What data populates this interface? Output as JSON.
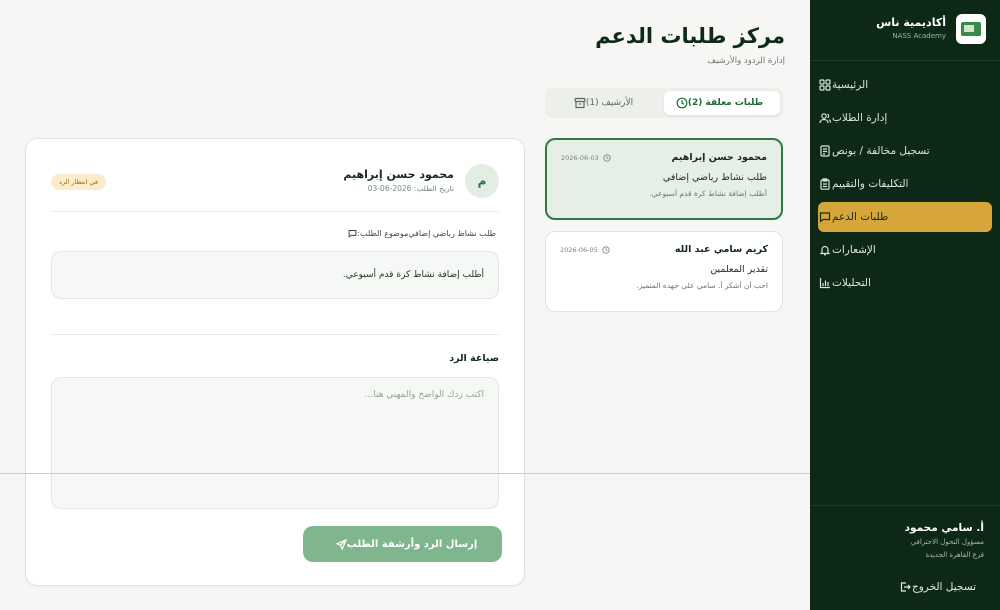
{
  "brand": {
    "name": "أكاديمية ناس",
    "subtitle": "NASS Academy"
  },
  "nav": {
    "items": [
      {
        "label": "الرئيسية",
        "icon": "grid-icon",
        "active": false
      },
      {
        "label": "إدارة الطلاب",
        "icon": "users-icon",
        "active": false
      },
      {
        "label": "تسجيل مخالفة / بونص",
        "icon": "note-icon",
        "active": false
      },
      {
        "label": "التكليفات والتقييم",
        "icon": "clipboard-icon",
        "active": false
      },
      {
        "label": "طلبات الدعم",
        "icon": "chat-icon",
        "active": true
      },
      {
        "label": "الإشعارات",
        "icon": "bell-icon",
        "active": false
      },
      {
        "label": "التحليلات",
        "icon": "chart-icon",
        "active": false
      }
    ]
  },
  "user": {
    "name": "أ. سامي محمود",
    "role": "مسؤول التحول الاحترافي",
    "branch": "فرع القاهرة الجديدة",
    "logout_label": "تسجيل الخروج"
  },
  "header": {
    "title": "مركز طلبات الدعم",
    "subtitle": "إدارة الردود والأرشيف"
  },
  "tabs": [
    {
      "label": "طلبات معلقة (2)",
      "icon": "clock-icon",
      "active": true
    },
    {
      "label": "الأرشيف (1)",
      "icon": "archive-icon",
      "active": false
    }
  ],
  "requests": [
    {
      "name": "محمود حسن إبراهيم",
      "date": "2026-06-03",
      "subject": "طلب نشاط رياضي إضافي",
      "preview": "أطلب إضافة نشاط كرة قدم أسبوعي."
    },
    {
      "name": "كريم سامي عبد الله",
      "date": "2026-06-05",
      "subject": "تقدير المعلمين",
      "preview": "احب أن أشكر أ. سامي على جهده المتميز."
    }
  ],
  "detail": {
    "avatar_letter": "م",
    "name": "محمود حسن إبراهيم",
    "date_line": "تاريخ الطلب: 2026-06-03",
    "status": "في انتظار الرد",
    "subject_label": "موضوع الطلب:",
    "subject_value": "طلب نشاط رياضي إضافي",
    "message": "أطلب إضافة نشاط كرة قدم أسبوعي.",
    "reply_label": "صياغة الرد",
    "reply_placeholder": "اكتب ردك الواضح والمهني هنا...",
    "reply_value": "",
    "send_label": "إرسال الرد وأرشفة الطلب"
  },
  "colors": {
    "sidebar": "#0e2816",
    "accent": "#d6a63a",
    "primary": "#2f7a43",
    "button": "#7fb68d",
    "badge": "#fbeccb"
  }
}
